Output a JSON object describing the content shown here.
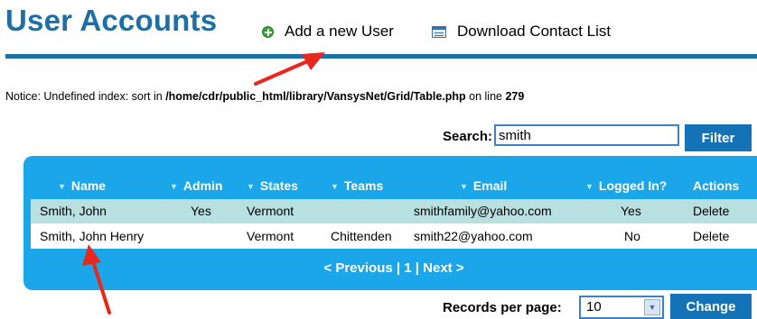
{
  "page": {
    "title": "User Accounts",
    "add_user_label": "Add a new User",
    "download_label": "Download Contact List"
  },
  "notice": {
    "prefix": "Notice",
    "message": ": Undefined index: sort in ",
    "path": "/home/cdr/public_html/library/VansysNet/Grid/Table.php",
    "on_line": " on line ",
    "line": "279"
  },
  "search": {
    "label": "Search:",
    "value": "smith",
    "filter_label": "Filter"
  },
  "grid": {
    "columns": [
      "Name",
      "Admin",
      "States",
      "Teams",
      "Email",
      "Logged In?",
      "Actions"
    ],
    "rows": [
      {
        "name": "Smith, John",
        "admin": "Yes",
        "states": "Vermont",
        "teams": "",
        "email": "smithfamily@yahoo.com",
        "logged_in": "Yes",
        "action": "Delete"
      },
      {
        "name": "Smith, John Henry",
        "admin": "",
        "states": "Vermont",
        "teams": "Chittenden",
        "email": "smith22@yahoo.com",
        "logged_in": "No",
        "action": "Delete"
      }
    ],
    "pager": {
      "previous": "< Previous",
      "separator": " | ",
      "page": "1",
      "next": "Next >"
    }
  },
  "records": {
    "label": "Records per page:",
    "selected": "10",
    "change_label": "Change"
  },
  "colors": {
    "title_blue": "#1e6fa5",
    "grid_blue": "#1aa6e8",
    "row_highlight": "#b9e0e0",
    "button_blue": "#1473b6",
    "arrow_red": "#e8271e"
  }
}
